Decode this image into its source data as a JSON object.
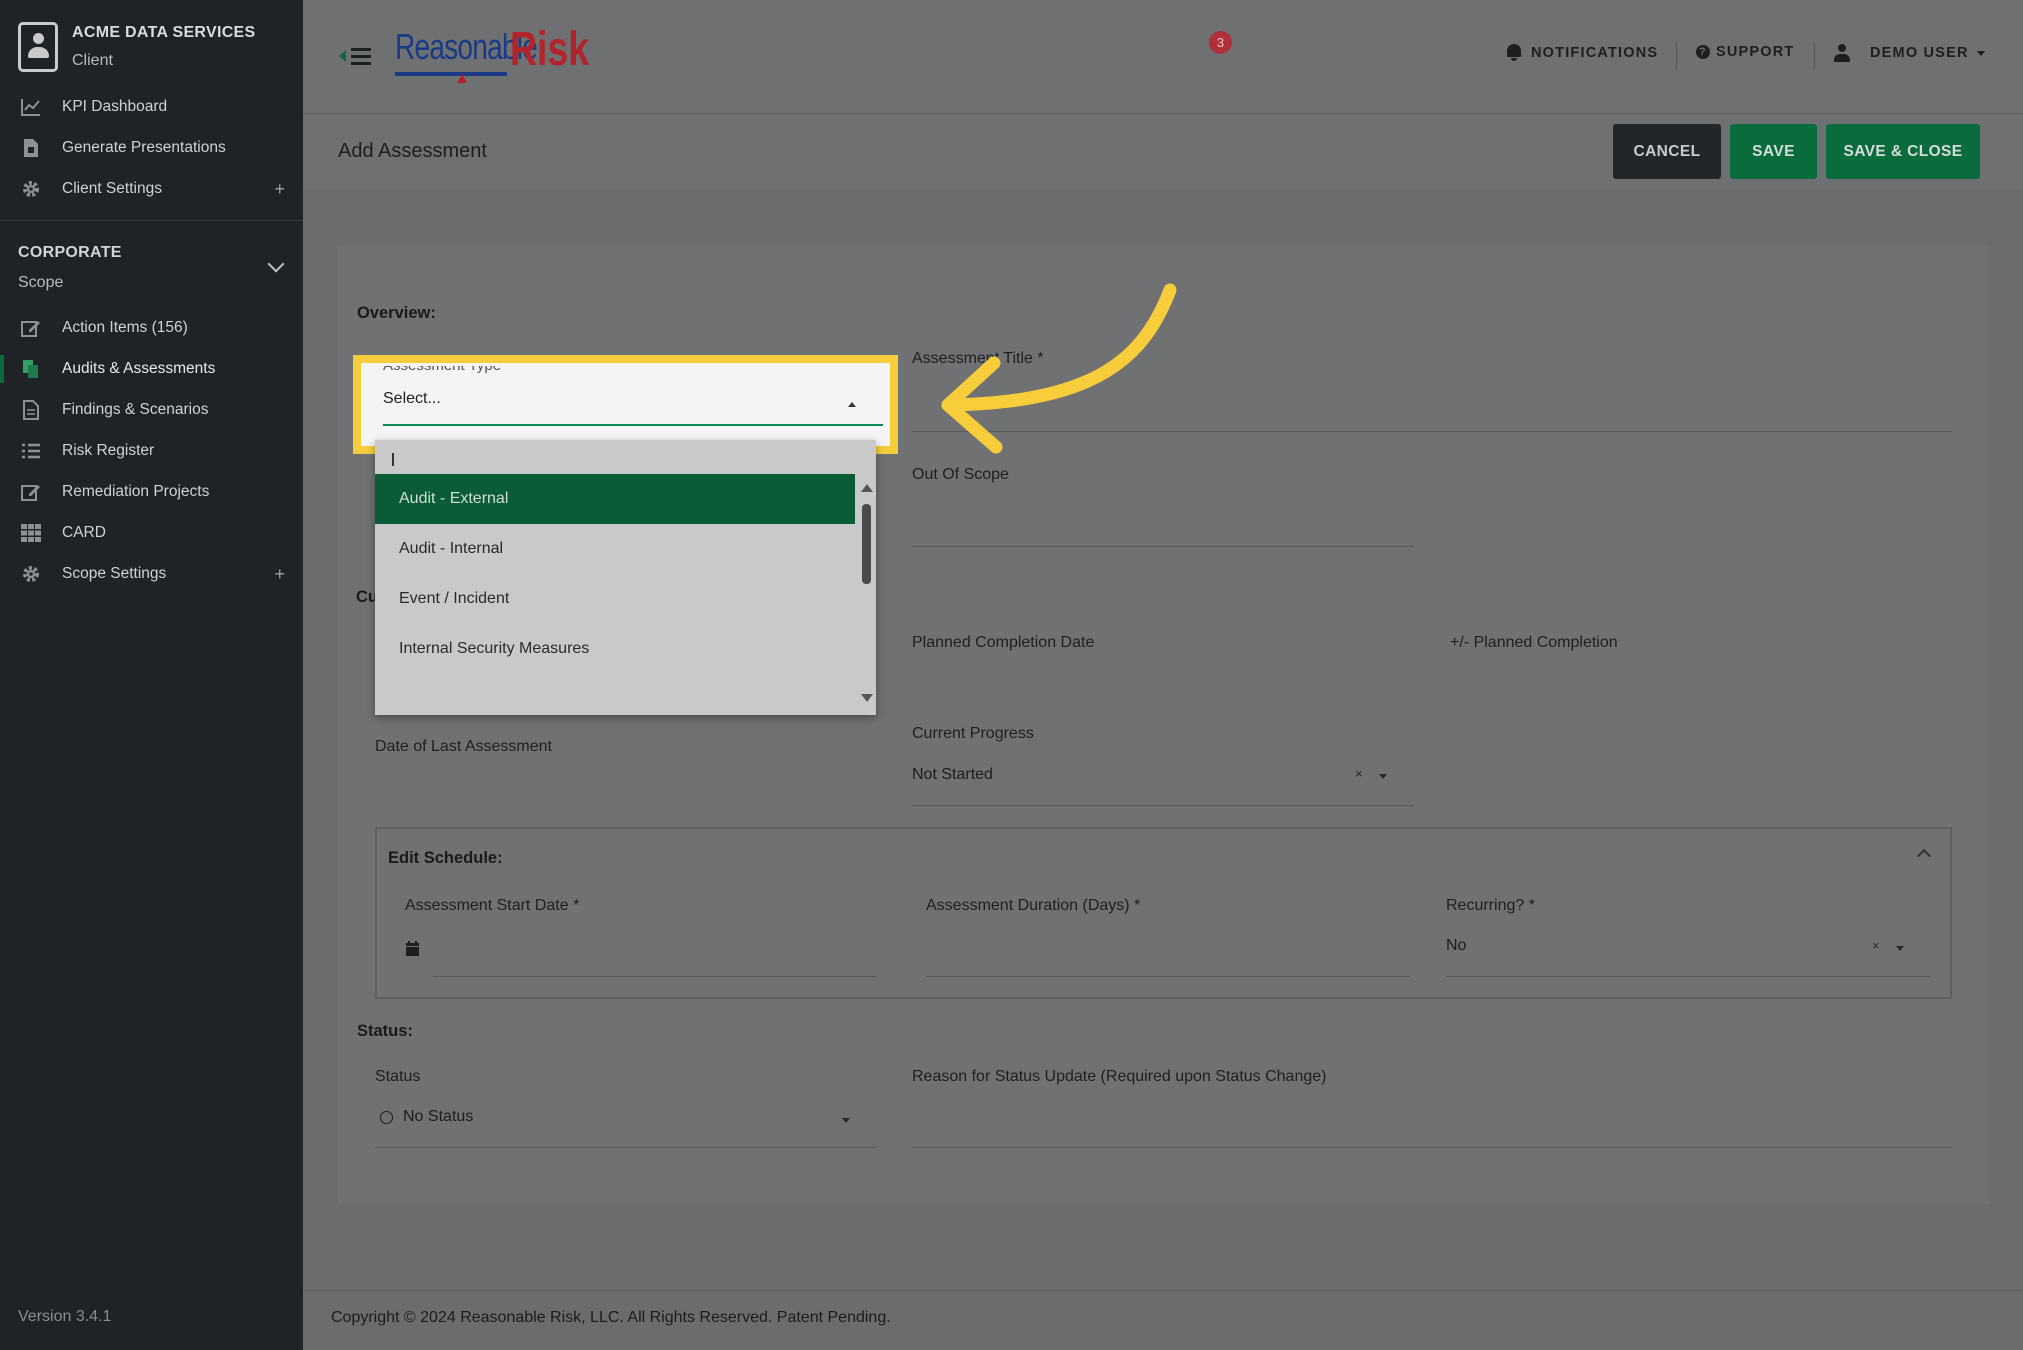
{
  "sidebar": {
    "client_name": "ACME DATA SERVICES",
    "client_sub": "Client",
    "top_items": [
      {
        "label": "KPI Dashboard",
        "icon": "line-chart-icon"
      },
      {
        "label": "Generate Presentations",
        "icon": "presentation-file-icon"
      },
      {
        "label": "Client Settings",
        "icon": "gear-icon",
        "expand": "+"
      }
    ],
    "scope_title": "CORPORATE",
    "scope_sub": "Scope",
    "scope_items": [
      {
        "label": "Action Items (156)",
        "icon": "edit-icon"
      },
      {
        "label": "Audits & Assessments",
        "icon": "copy-icon",
        "active": true
      },
      {
        "label": "Findings & Scenarios",
        "icon": "document-icon"
      },
      {
        "label": "Risk Register",
        "icon": "list-icon"
      },
      {
        "label": "Remediation Projects",
        "icon": "edit-icon"
      },
      {
        "label": "CARD",
        "icon": "grid-icon"
      },
      {
        "label": "Scope Settings",
        "icon": "gear-icon",
        "expand": "+"
      }
    ],
    "version": "Version 3.4.1"
  },
  "header": {
    "logo_part1": "Reasonable",
    "logo_part2": "Risk",
    "notifications_label": "NOTIFICATIONS",
    "notifications_count": "3",
    "support_label": "SUPPORT",
    "user_label": "DEMO USER"
  },
  "titlebar": {
    "title": "Add Assessment",
    "cancel": "CANCEL",
    "save": "SAVE",
    "save_close": "SAVE & CLOSE"
  },
  "form": {
    "overview_label": "Overview:",
    "assessment_type_label": "Assessment Type",
    "assessment_type_value": "Select...",
    "assessment_title_label": "Assessment Title *",
    "out_of_scope_label": "Out Of Scope",
    "current_prefix": "Cu",
    "planned_completion_label": "Planned Completion Date",
    "planned_completion_delta_label": "+/- Planned Completion",
    "date_last_assessment_label": "Date of Last Assessment",
    "current_progress_label": "Current Progress",
    "current_progress_value": "Not Started",
    "schedule_label": "Edit Schedule:",
    "start_date_label": "Assessment Start Date *",
    "duration_label": "Assessment Duration (Days) *",
    "recurring_label": "Recurring? *",
    "recurring_value": "No",
    "status_section": "Status:",
    "status_label": "Status",
    "status_value": "No Status",
    "reason_label": "Reason for Status Update (Required upon Status Change)",
    "clear_symbol": "×"
  },
  "dropdown": {
    "options": [
      "Audit - External",
      "Audit - Internal",
      "Event / Incident",
      "Internal Security Measures"
    ],
    "selected": "Audit - External"
  },
  "footer": {
    "copyright": "Copyright © 2024 Reasonable Risk, LLC. All Rights Reserved. Patent Pending."
  },
  "colors": {
    "accent_green": "#0a6b3c",
    "highlight_yellow": "#f7cd3b",
    "badge_red": "#b03039"
  }
}
